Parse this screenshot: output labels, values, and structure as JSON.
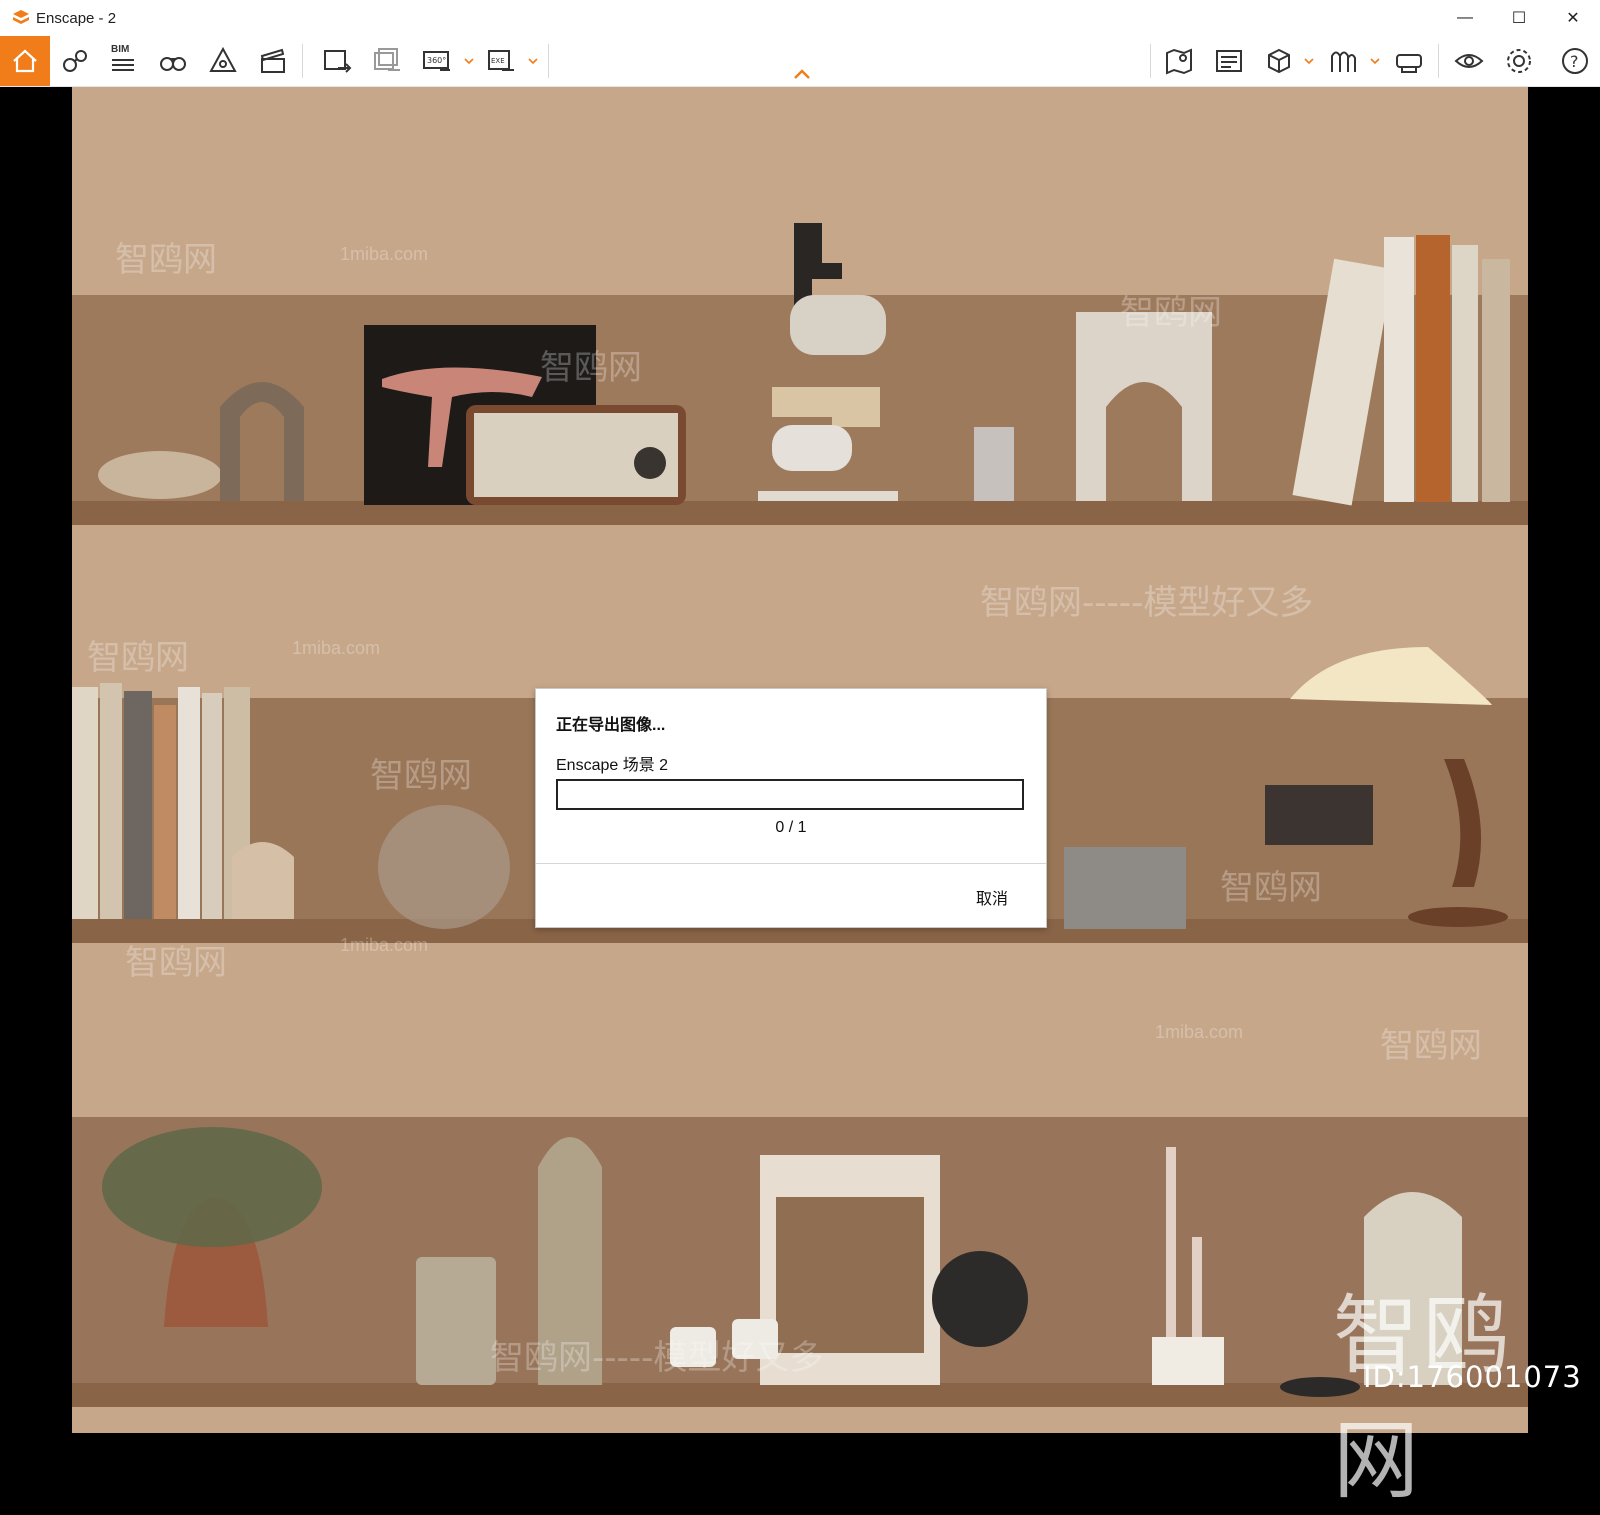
{
  "window": {
    "title": "Enscape - 2",
    "controls": {
      "minimize": "—",
      "maximize": "☐",
      "close": "✕"
    }
  },
  "toolbar": {
    "bim_label": "BIM",
    "icons_left": [
      "home-icon",
      "asset-library-icon",
      "bim-list-icon",
      "binoculars-icon",
      "views-icon",
      "video-editor-icon",
      "screenshot-export-icon",
      "batch-export-icon",
      "panorama-360-export-icon",
      "exe-export-icon"
    ],
    "icons_right": [
      "map-icon",
      "material-editor-icon",
      "cube-view-icon",
      "walkthrough-icon",
      "vr-headset-icon",
      "visual-settings-icon",
      "settings-gear-icon",
      "help-icon"
    ],
    "accent_color": "#f07d1a"
  },
  "dialog": {
    "title": "正在导出图像...",
    "item_name": "Enscape 场景 2",
    "progress_fraction": 0,
    "count_text": "0 / 1",
    "cancel_label": "取消"
  },
  "watermark": {
    "logo_text": "智鸥网",
    "id_text": "ID:176001073",
    "repeat_text": "智鸥网",
    "repeat_url": "1miba.com",
    "repeat_slogan": "智鸥网-----模型好又多"
  }
}
